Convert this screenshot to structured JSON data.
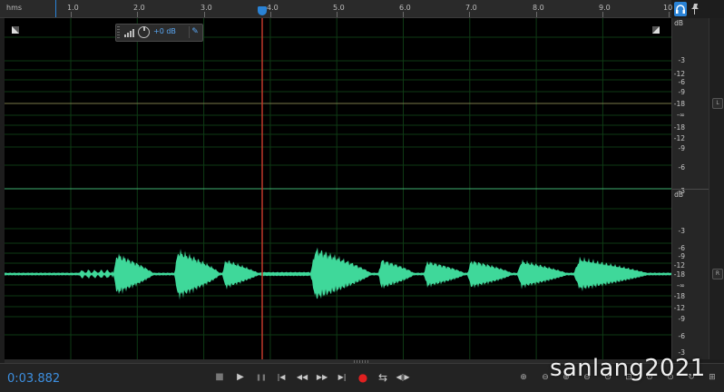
{
  "ruler": {
    "units_label": "hms",
    "ticks": [
      "1.0",
      "2.0",
      "3.0",
      "4.0",
      "5.0",
      "6.0",
      "7.0",
      "8.0",
      "9.0",
      "10"
    ]
  },
  "hud": {
    "gain_value": "+0 dB"
  },
  "scale": {
    "top_unit": "dB",
    "left_channel": [
      "-3",
      "-6",
      "-9",
      "-12",
      "-18",
      "-∞",
      "-18",
      "-12",
      "-9",
      "-6",
      "-3"
    ],
    "bottom_unit": "dB",
    "right_channel": [
      "-3",
      "-6",
      "-9",
      "-12",
      "-18",
      "-∞",
      "-18",
      "-12",
      "-9",
      "-6",
      "-3"
    ],
    "left_badge": "L",
    "right_badge": "R"
  },
  "status": {
    "timecode": "0:03.882"
  },
  "transport": {
    "stop": "■",
    "play": "▶",
    "pause": "❚❚",
    "prev": "|◀",
    "rewind": "◀◀",
    "forward": "▶▶",
    "next": "▶|",
    "record": "●",
    "loop": "⇆",
    "skip": "◀|▶"
  },
  "watermark": "sanlang2021",
  "colors": {
    "waveform": "#3fd89a",
    "playhead": "#c0392b",
    "accent": "#2a83d6",
    "grid": "#0e3a14"
  }
}
